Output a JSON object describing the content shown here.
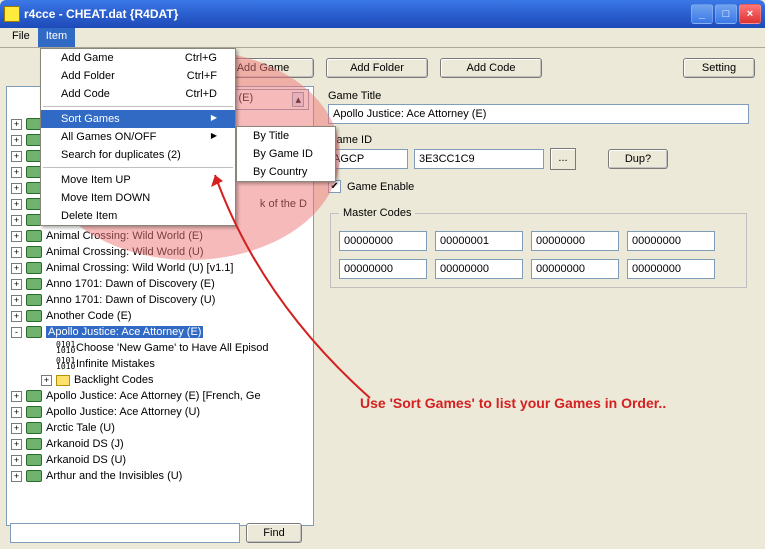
{
  "window": {
    "title": "r4cce - CHEAT.dat {R4DAT}"
  },
  "menubar": {
    "file": "File",
    "item": "Item"
  },
  "menu": {
    "add_game": "Add Game",
    "add_game_sc": "Ctrl+G",
    "add_folder": "Add Folder",
    "add_folder_sc": "Ctrl+F",
    "add_code": "Add Code",
    "add_code_sc": "Ctrl+D",
    "sort_games": "Sort Games",
    "all_games_onoff": "All Games ON/OFF",
    "search_dup": "Search for duplicates (2)",
    "move_up": "Move Item UP",
    "move_down": "Move Item DOWN",
    "delete_item": "Delete Item"
  },
  "submenu": {
    "by_title": "By Title",
    "by_game_id": "By Game ID",
    "by_country": "By Country"
  },
  "toolbar": {
    "add_game": "Add Game",
    "add_folder": "Add Folder",
    "add_code": "Add Code",
    "setting": "Setting"
  },
  "games_select": "Games (E)",
  "tree": [
    {
      "label": "",
      "exp": "+",
      "kind": "ds"
    },
    {
      "label": "",
      "exp": "+",
      "kind": "ds"
    },
    {
      "label": "",
      "exp": "+",
      "kind": "ds"
    },
    {
      "label": "",
      "exp": "+",
      "kind": "ds"
    },
    {
      "label": "",
      "exp": "+",
      "kind": "ds"
    },
    {
      "label": "",
      "exp": "+",
      "kind": "ds",
      "extra": "k of the D"
    },
    {
      "label": "",
      "exp": "+",
      "kind": "ds"
    },
    {
      "label": "Animal Crossing: Wild World (E)",
      "exp": "+",
      "kind": "ds"
    },
    {
      "label": "Animal Crossing: Wild World (U)",
      "exp": "+",
      "kind": "ds"
    },
    {
      "label": "Animal Crossing: Wild World (U) [v1.1]",
      "exp": "+",
      "kind": "ds"
    },
    {
      "label": "Anno 1701: Dawn of Discovery (E)",
      "exp": "+",
      "kind": "ds"
    },
    {
      "label": "Anno 1701: Dawn of Discovery (U)",
      "exp": "+",
      "kind": "ds"
    },
    {
      "label": "Another Code (E)",
      "exp": "+",
      "kind": "ds"
    },
    {
      "label": "Apollo Justice: Ace Attorney (E)",
      "exp": "-",
      "kind": "ds",
      "sel": true
    },
    {
      "label": "Choose 'New Game' to Have All Episod",
      "kind": "bin",
      "child": true
    },
    {
      "label": "Infinite Mistakes",
      "kind": "bin",
      "child": true
    },
    {
      "label": "Backlight Codes",
      "kind": "folder",
      "child": true,
      "exp": "+"
    },
    {
      "label": "Apollo Justice: Ace Attorney (E) [French, Ge",
      "exp": "+",
      "kind": "ds"
    },
    {
      "label": "Apollo Justice: Ace Attorney (U)",
      "exp": "+",
      "kind": "ds"
    },
    {
      "label": "Arctic Tale (U)",
      "exp": "+",
      "kind": "ds"
    },
    {
      "label": "Arkanoid DS (J)",
      "exp": "+",
      "kind": "ds"
    },
    {
      "label": "Arkanoid DS (U)",
      "exp": "+",
      "kind": "ds"
    },
    {
      "label": "Arthur and the Invisibles (U)",
      "exp": "+",
      "kind": "ds"
    }
  ],
  "form": {
    "game_title_label": "Game Title",
    "game_title": "Apollo Justice: Ace Attorney (E)",
    "game_id_label": "Game ID",
    "game_id1": "AGCP",
    "game_id2": "3E3CC1C9",
    "browse": "...",
    "dup": "Dup?",
    "game_enable": "Game Enable",
    "master_codes": "Master Codes",
    "codes": [
      "00000000",
      "00000001",
      "00000000",
      "00000000",
      "00000000",
      "00000000",
      "00000000",
      "00000000"
    ]
  },
  "find": {
    "label": "Find"
  },
  "annotation": "Use 'Sort Games' to list your Games in Order.."
}
